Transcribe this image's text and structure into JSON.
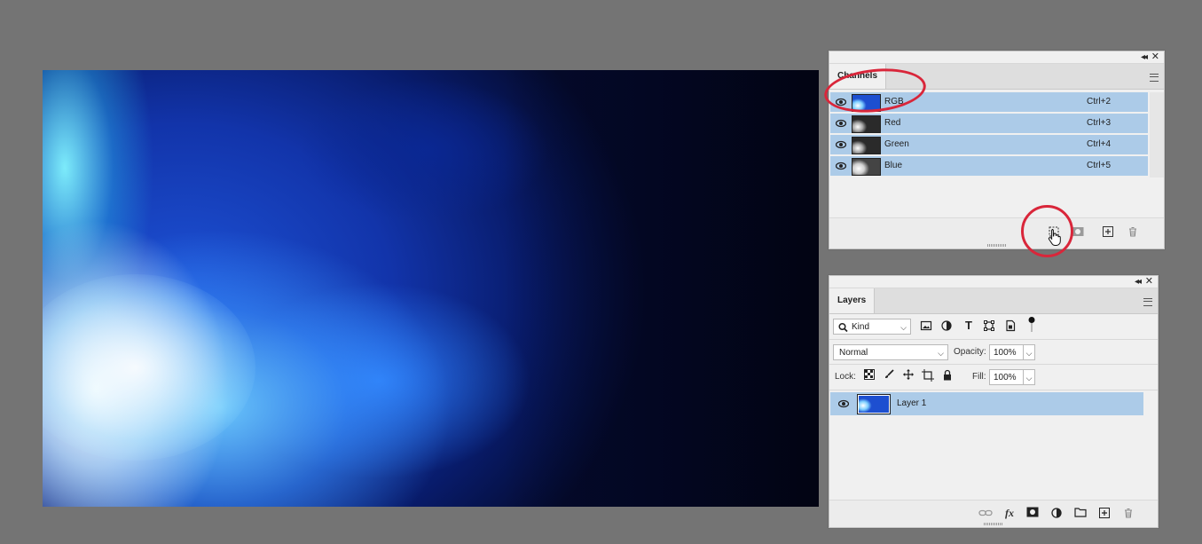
{
  "canvas": {
    "description_name": "blue-light-photo"
  },
  "channels_panel": {
    "tab_label": "Channels",
    "channels": [
      {
        "name": "RGB",
        "shortcut": "Ctrl+2"
      },
      {
        "name": "Red",
        "shortcut": "Ctrl+3"
      },
      {
        "name": "Green",
        "shortcut": "Ctrl+4"
      },
      {
        "name": "Blue",
        "shortcut": "Ctrl+5"
      }
    ],
    "footer_icons": [
      "load-selection-icon",
      "save-selection-icon",
      "new-channel-icon",
      "trash-icon"
    ]
  },
  "layers_panel": {
    "tab_label": "Layers",
    "filter": {
      "kind_label": "Kind"
    },
    "blend_mode": "Normal",
    "opacity_label": "Opacity:",
    "opacity_value": "100%",
    "lock_label": "Lock:",
    "fill_label": "Fill:",
    "fill_value": "100%",
    "layers": [
      {
        "name": "Layer 1"
      }
    ],
    "footer_icons": [
      "link-icon",
      "fx-icon",
      "mask-icon",
      "adjustment-icon",
      "folder-icon",
      "new-layer-icon",
      "trash-icon"
    ]
  },
  "colors": {
    "selection_row": "#accbe8",
    "annotation": "#d9263a",
    "workspace": "#747474"
  }
}
